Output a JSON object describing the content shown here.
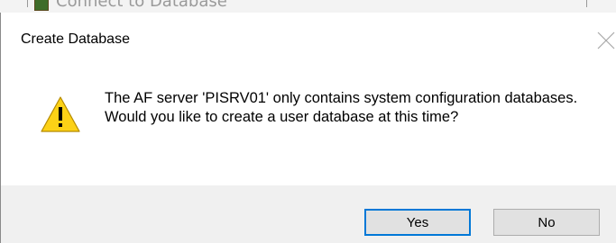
{
  "parent_window": {
    "title": "Connect to Database"
  },
  "dialog": {
    "title": "Create Database",
    "close_icon": "close-icon",
    "icon": "warning-icon",
    "message": "The AF server 'PISRV01' only contains system configuration databases.  Would you like to create a user database at this time?",
    "buttons": {
      "yes_label": "Yes",
      "no_label": "No"
    }
  },
  "colors": {
    "accent": "#0078d7",
    "warning_fill": "#fcd116",
    "button_bar": "#f0f0f0"
  }
}
